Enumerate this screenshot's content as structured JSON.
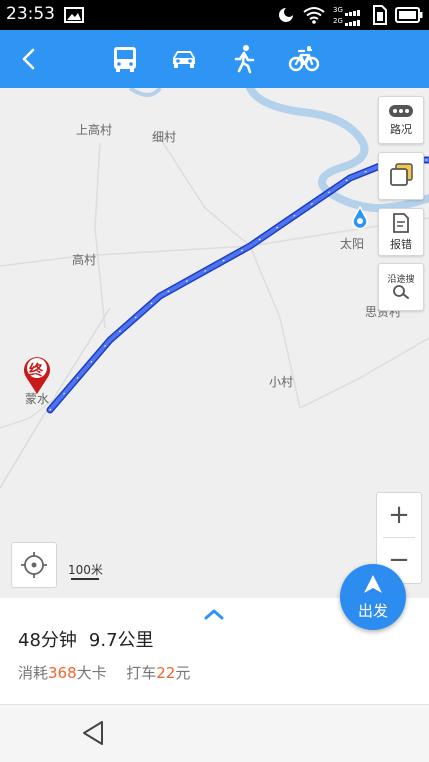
{
  "status_bar": {
    "time": "23:53",
    "net_top": "3G",
    "net_bottom": "2G"
  },
  "nav": {
    "modes": [
      {
        "icon": "bus-icon",
        "name": "公交"
      },
      {
        "icon": "car-icon",
        "name": "驾车"
      },
      {
        "icon": "walk-icon",
        "name": "步行"
      },
      {
        "icon": "bike-icon",
        "name": "骑行"
      }
    ],
    "selected_mode": "bike-icon",
    "accent": "#2f95f5"
  },
  "map": {
    "labels": {
      "shanggaocun": "上高村",
      "xicun": "细村",
      "gaocun": "高村",
      "taiyang": "太阳",
      "sixiancun": "思贤村",
      "xiaocun": "小村",
      "mengshui": "蒙水"
    },
    "end_marker": "终",
    "side_buttons": {
      "traffic": "路况",
      "report": "报错",
      "along_search": "沿途搜"
    },
    "scale": "100米",
    "route_color": "#3b5ee0"
  },
  "go_button": {
    "label": "出发"
  },
  "summary": {
    "duration": "48分钟",
    "distance": "9.7公里",
    "calorie_prefix": "消耗",
    "calorie_value": "368",
    "calorie_suffix": "大卡",
    "taxi_prefix": "打车",
    "taxi_value": "22",
    "taxi_suffix": "元"
  }
}
